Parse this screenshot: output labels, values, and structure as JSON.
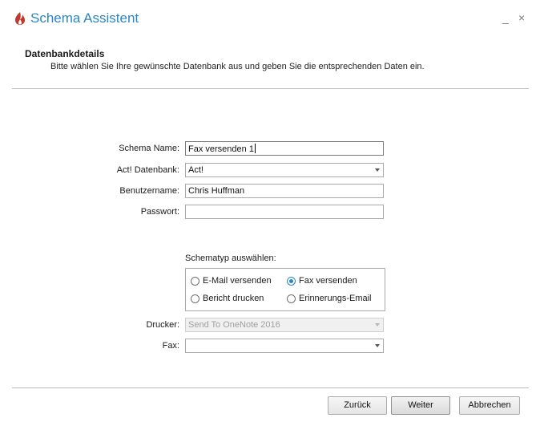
{
  "window": {
    "title": "Schema Assistent",
    "minimize_glyph": "_",
    "close_glyph": "×",
    "accent_color": "#2b86c5",
    "icon_color": "#c0392b"
  },
  "header": {
    "section_title": "Datenbankdetails",
    "description": "Bitte wählen Sie Ihre gewünschte Datenbank aus und geben Sie die entsprechenden Daten ein."
  },
  "form": {
    "schema_name": {
      "label": "Schema Name:",
      "value": "Fax versenden 1"
    },
    "database": {
      "label": "Act! Datenbank:",
      "value": "Act!"
    },
    "username": {
      "label": "Benutzername:",
      "value": "Chris Huffman"
    },
    "password": {
      "label": "Passwort:",
      "value": ""
    },
    "schema_type": {
      "label": "Schematyp auswählen:",
      "options": [
        {
          "label": "E-Mail versenden",
          "checked": false
        },
        {
          "label": "Fax versenden",
          "checked": true
        },
        {
          "label": "Bericht drucken",
          "checked": false
        },
        {
          "label": "Erinnerungs-Email",
          "checked": false
        }
      ]
    },
    "printer": {
      "label": "Drucker:",
      "value": "Send To OneNote 2016",
      "disabled": true
    },
    "fax": {
      "label": "Fax:",
      "value": ""
    }
  },
  "footer": {
    "back_label": "Zurück",
    "next_label": "Weiter",
    "cancel_label": "Abbrechen"
  }
}
